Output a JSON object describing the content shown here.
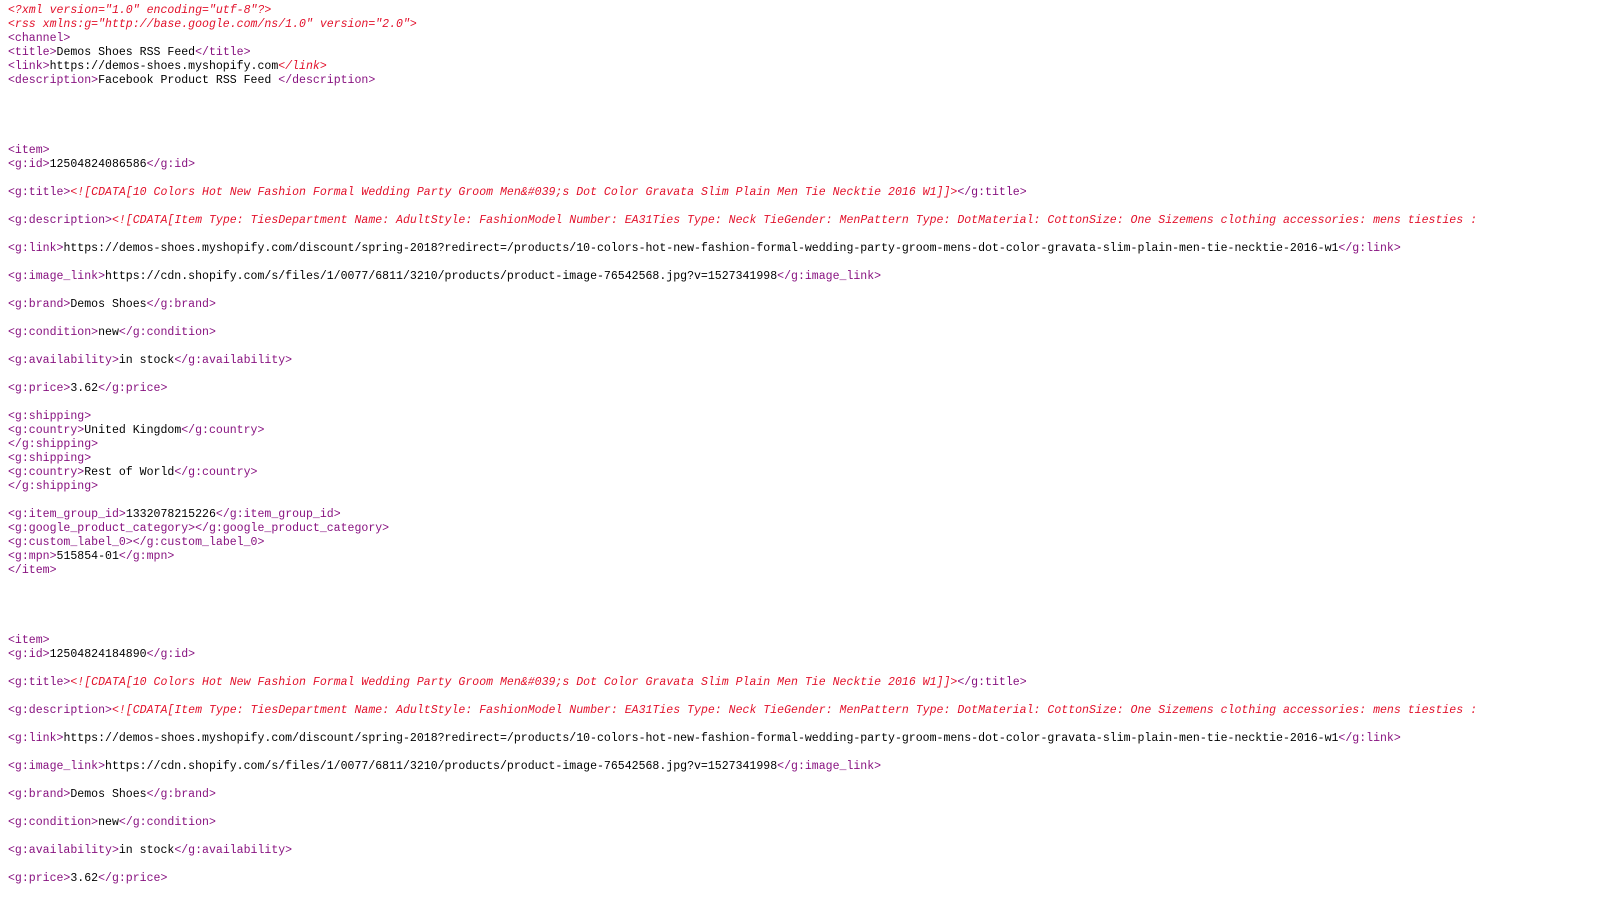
{
  "colors": {
    "tag": "#881280",
    "declaration": "#e2112b",
    "cdata": "#e2112b",
    "text": "#000000",
    "background": "#ffffff"
  },
  "lines": [
    {
      "kind": "line",
      "parts": [
        {
          "t": "decl",
          "v": "<?xml version=\"1.0\" encoding=\"utf-8\"?>"
        }
      ]
    },
    {
      "kind": "line",
      "parts": [
        {
          "t": "decl",
          "v": "<rss xmlns:g=\"http://base.google.com/ns/1.0\" version=\"2.0\">"
        }
      ]
    },
    {
      "kind": "line",
      "parts": [
        {
          "t": "tag",
          "v": "<channel>"
        }
      ]
    },
    {
      "kind": "line",
      "parts": [
        {
          "t": "tag",
          "v": "<title>"
        },
        {
          "t": "txt",
          "v": "Demos Shoes RSS Feed"
        },
        {
          "t": "tag",
          "v": "</title>"
        }
      ]
    },
    {
      "kind": "line",
      "parts": [
        {
          "t": "tag",
          "v": "<link>"
        },
        {
          "t": "txt",
          "v": "https://demos-shoes.myshopify.com"
        },
        {
          "t": "decl",
          "v": "</link>"
        }
      ]
    },
    {
      "kind": "line",
      "parts": [
        {
          "t": "tag",
          "v": "<description>"
        },
        {
          "t": "txt",
          "v": "Facebook Product RSS Feed "
        },
        {
          "t": "tag",
          "v": "</description>"
        }
      ]
    },
    {
      "kind": "blank"
    },
    {
      "kind": "blank"
    },
    {
      "kind": "blank"
    },
    {
      "kind": "blank"
    },
    {
      "kind": "line",
      "parts": [
        {
          "t": "tag",
          "v": "<item>"
        }
      ]
    },
    {
      "kind": "line",
      "parts": [
        {
          "t": "tag",
          "v": "<g:id>"
        },
        {
          "t": "txt",
          "v": "12504824086586"
        },
        {
          "t": "tag",
          "v": "</g:id>"
        }
      ]
    },
    {
      "kind": "blank"
    },
    {
      "kind": "line",
      "parts": [
        {
          "t": "tag",
          "v": "<g:title>"
        },
        {
          "t": "cdata",
          "v": "<![CDATA[10 Colors Hot New Fashion Formal Wedding Party Groom Men&#039;s Dot Color Gravata Slim Plain Men Tie Necktie 2016 W1]]>"
        },
        {
          "t": "tag",
          "v": "</g:title>"
        }
      ]
    },
    {
      "kind": "blank"
    },
    {
      "kind": "line",
      "parts": [
        {
          "t": "tag",
          "v": "<g:description>"
        },
        {
          "t": "cdata",
          "v": "<![CDATA[Item Type: TiesDepartment Name: AdultStyle: FashionModel Number: EA31Ties Type: Neck TieGender: MenPattern Type: DotMaterial: CottonSize: One Sizemens clothing accessories: mens tiesties :"
        }
      ]
    },
    {
      "kind": "blank"
    },
    {
      "kind": "line",
      "parts": [
        {
          "t": "tag",
          "v": "<g:link>"
        },
        {
          "t": "txt",
          "v": "https://demos-shoes.myshopify.com/discount/spring-2018?redirect=/products/10-colors-hot-new-fashion-formal-wedding-party-groom-mens-dot-color-gravata-slim-plain-men-tie-necktie-2016-w1"
        },
        {
          "t": "tag",
          "v": "</g:link>"
        }
      ]
    },
    {
      "kind": "blank"
    },
    {
      "kind": "line",
      "parts": [
        {
          "t": "tag",
          "v": "<g:image_link>"
        },
        {
          "t": "txt",
          "v": "https://cdn.shopify.com/s/files/1/0077/6811/3210/products/product-image-76542568.jpg?v=1527341998"
        },
        {
          "t": "tag",
          "v": "</g:image_link>"
        }
      ]
    },
    {
      "kind": "blank"
    },
    {
      "kind": "line",
      "parts": [
        {
          "t": "tag",
          "v": "<g:brand>"
        },
        {
          "t": "txt",
          "v": "Demos Shoes"
        },
        {
          "t": "tag",
          "v": "</g:brand>"
        }
      ]
    },
    {
      "kind": "blank"
    },
    {
      "kind": "line",
      "parts": [
        {
          "t": "tag",
          "v": "<g:condition>"
        },
        {
          "t": "txt",
          "v": "new"
        },
        {
          "t": "tag",
          "v": "</g:condition>"
        }
      ]
    },
    {
      "kind": "blank"
    },
    {
      "kind": "line",
      "parts": [
        {
          "t": "tag",
          "v": "<g:availability>"
        },
        {
          "t": "txt",
          "v": "in stock"
        },
        {
          "t": "tag",
          "v": "</g:availability>"
        }
      ]
    },
    {
      "kind": "blank"
    },
    {
      "kind": "line",
      "parts": [
        {
          "t": "tag",
          "v": "<g:price>"
        },
        {
          "t": "txt",
          "v": "3.62"
        },
        {
          "t": "tag",
          "v": "</g:price>"
        }
      ]
    },
    {
      "kind": "blank"
    },
    {
      "kind": "line",
      "parts": [
        {
          "t": "tag",
          "v": "<g:shipping>"
        }
      ]
    },
    {
      "kind": "line",
      "parts": [
        {
          "t": "tag",
          "v": "<g:country>"
        },
        {
          "t": "txt",
          "v": "United Kingdom"
        },
        {
          "t": "tag",
          "v": "</g:country>"
        }
      ]
    },
    {
      "kind": "line",
      "parts": [
        {
          "t": "tag",
          "v": "</g:shipping>"
        }
      ]
    },
    {
      "kind": "line",
      "parts": [
        {
          "t": "tag",
          "v": "<g:shipping>"
        }
      ]
    },
    {
      "kind": "line",
      "parts": [
        {
          "t": "tag",
          "v": "<g:country>"
        },
        {
          "t": "txt",
          "v": "Rest of World"
        },
        {
          "t": "tag",
          "v": "</g:country>"
        }
      ]
    },
    {
      "kind": "line",
      "parts": [
        {
          "t": "tag",
          "v": "</g:shipping>"
        }
      ]
    },
    {
      "kind": "blank"
    },
    {
      "kind": "line",
      "parts": [
        {
          "t": "tag",
          "v": "<g:item_group_id>"
        },
        {
          "t": "txt",
          "v": "1332078215226"
        },
        {
          "t": "tag",
          "v": "</g:item_group_id>"
        }
      ]
    },
    {
      "kind": "line",
      "parts": [
        {
          "t": "tag",
          "v": "<g:google_product_category>"
        },
        {
          "t": "tag",
          "v": "</g:google_product_category>"
        }
      ]
    },
    {
      "kind": "line",
      "parts": [
        {
          "t": "tag",
          "v": "<g:custom_label_0>"
        },
        {
          "t": "tag",
          "v": "</g:custom_label_0>"
        }
      ]
    },
    {
      "kind": "line",
      "parts": [
        {
          "t": "tag",
          "v": "<g:mpn>"
        },
        {
          "t": "txt",
          "v": "515854-01"
        },
        {
          "t": "tag",
          "v": "</g:mpn>"
        }
      ]
    },
    {
      "kind": "line",
      "parts": [
        {
          "t": "tag",
          "v": "</item>"
        }
      ]
    },
    {
      "kind": "blank"
    },
    {
      "kind": "blank"
    },
    {
      "kind": "blank"
    },
    {
      "kind": "blank"
    },
    {
      "kind": "line",
      "parts": [
        {
          "t": "tag",
          "v": "<item>"
        }
      ]
    },
    {
      "kind": "line",
      "parts": [
        {
          "t": "tag",
          "v": "<g:id>"
        },
        {
          "t": "txt",
          "v": "12504824184890"
        },
        {
          "t": "tag",
          "v": "</g:id>"
        }
      ]
    },
    {
      "kind": "blank"
    },
    {
      "kind": "line",
      "parts": [
        {
          "t": "tag",
          "v": "<g:title>"
        },
        {
          "t": "cdata",
          "v": "<![CDATA[10 Colors Hot New Fashion Formal Wedding Party Groom Men&#039;s Dot Color Gravata Slim Plain Men Tie Necktie 2016 W1]]>"
        },
        {
          "t": "tag",
          "v": "</g:title>"
        }
      ]
    },
    {
      "kind": "blank"
    },
    {
      "kind": "line",
      "parts": [
        {
          "t": "tag",
          "v": "<g:description>"
        },
        {
          "t": "cdata",
          "v": "<![CDATA[Item Type: TiesDepartment Name: AdultStyle: FashionModel Number: EA31Ties Type: Neck TieGender: MenPattern Type: DotMaterial: CottonSize: One Sizemens clothing accessories: mens tiesties :"
        }
      ]
    },
    {
      "kind": "blank"
    },
    {
      "kind": "line",
      "parts": [
        {
          "t": "tag",
          "v": "<g:link>"
        },
        {
          "t": "txt",
          "v": "https://demos-shoes.myshopify.com/discount/spring-2018?redirect=/products/10-colors-hot-new-fashion-formal-wedding-party-groom-mens-dot-color-gravata-slim-plain-men-tie-necktie-2016-w1"
        },
        {
          "t": "tag",
          "v": "</g:link>"
        }
      ]
    },
    {
      "kind": "blank"
    },
    {
      "kind": "line",
      "parts": [
        {
          "t": "tag",
          "v": "<g:image_link>"
        },
        {
          "t": "txt",
          "v": "https://cdn.shopify.com/s/files/1/0077/6811/3210/products/product-image-76542568.jpg?v=1527341998"
        },
        {
          "t": "tag",
          "v": "</g:image_link>"
        }
      ]
    },
    {
      "kind": "blank"
    },
    {
      "kind": "line",
      "parts": [
        {
          "t": "tag",
          "v": "<g:brand>"
        },
        {
          "t": "txt",
          "v": "Demos Shoes"
        },
        {
          "t": "tag",
          "v": "</g:brand>"
        }
      ]
    },
    {
      "kind": "blank"
    },
    {
      "kind": "line",
      "parts": [
        {
          "t": "tag",
          "v": "<g:condition>"
        },
        {
          "t": "txt",
          "v": "new"
        },
        {
          "t": "tag",
          "v": "</g:condition>"
        }
      ]
    },
    {
      "kind": "blank"
    },
    {
      "kind": "line",
      "parts": [
        {
          "t": "tag",
          "v": "<g:availability>"
        },
        {
          "t": "txt",
          "v": "in stock"
        },
        {
          "t": "tag",
          "v": "</g:availability>"
        }
      ]
    },
    {
      "kind": "blank"
    },
    {
      "kind": "line",
      "parts": [
        {
          "t": "tag",
          "v": "<g:price>"
        },
        {
          "t": "txt",
          "v": "3.62"
        },
        {
          "t": "tag",
          "v": "</g:price>"
        }
      ]
    }
  ]
}
